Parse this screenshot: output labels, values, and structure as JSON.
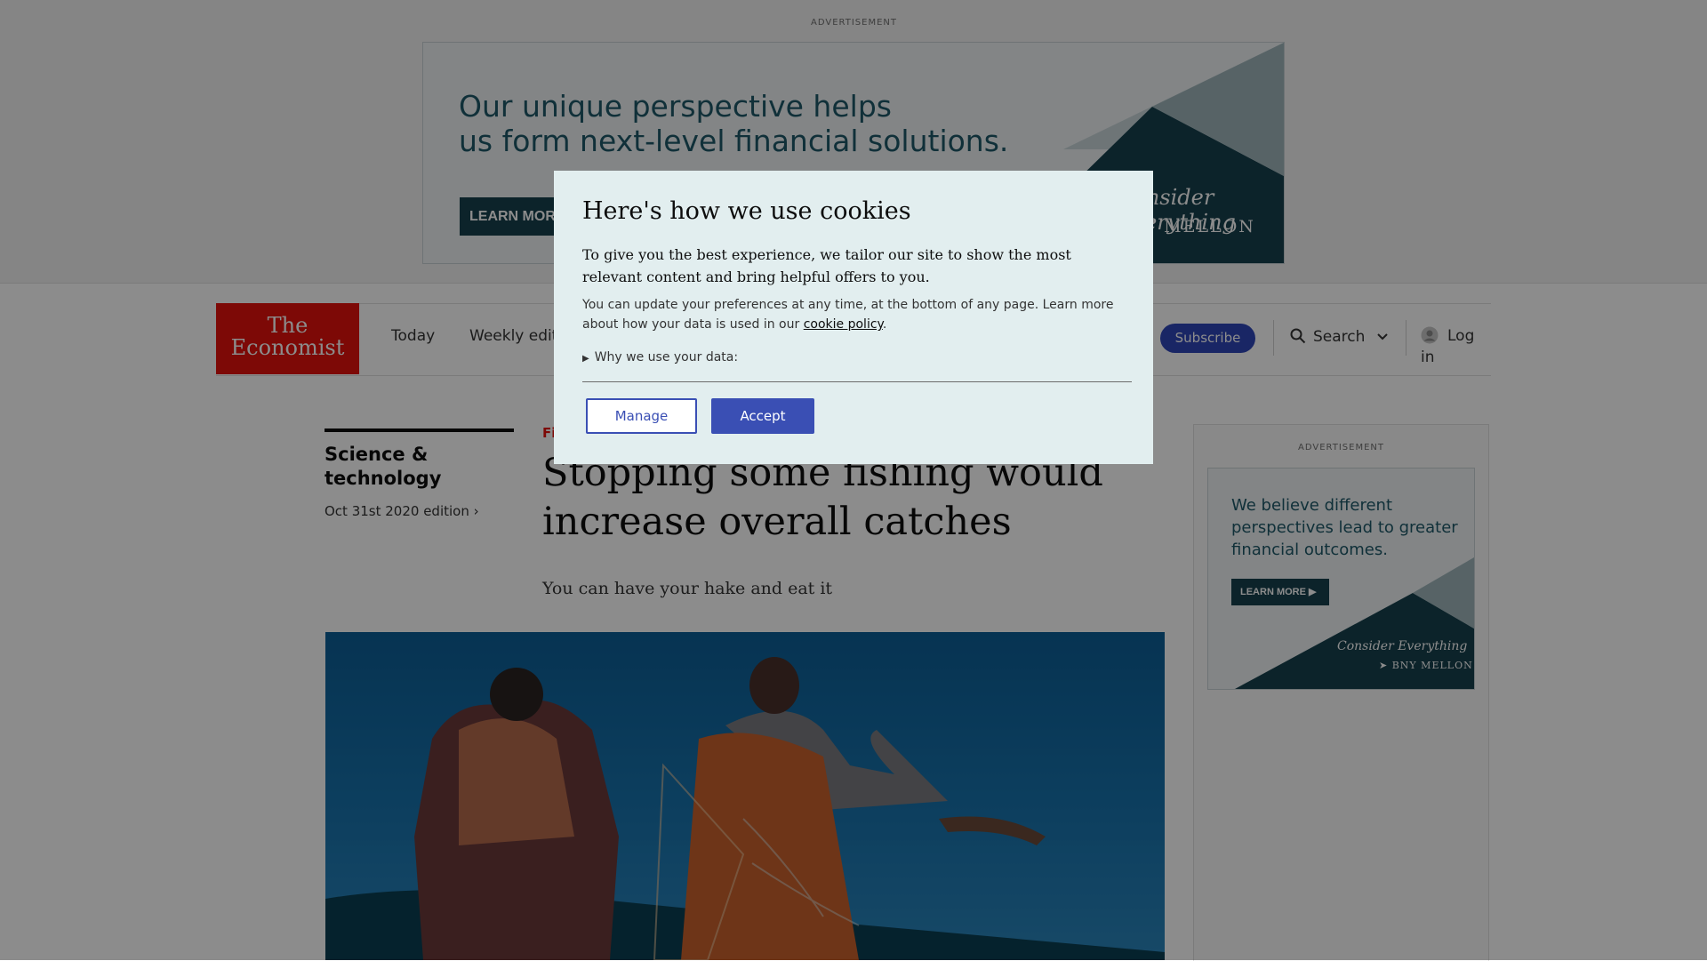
{
  "top_ad": {
    "label": "ADVERTISEMENT",
    "headline_line1": "Our unique perspective helps",
    "headline_line2": "us form next-level financial solutions.",
    "button": "LEARN MORE",
    "tagline": "Consider Everything",
    "brand": "BNY MELLON"
  },
  "nav": {
    "logo_line1": "The",
    "logo_line2": "Economist",
    "links": [
      "Today",
      "Weekly edition"
    ],
    "subscribe": "Subscribe",
    "search": "Search",
    "login": "Log in"
  },
  "article": {
    "section": "Science & technology",
    "edition": "Oct 31st 2020 edition",
    "kicker": "Fisheries",
    "headline": "Stopping some fishing would increase overall catches",
    "standfirst": "You can have your hake and eat it"
  },
  "side_ad": {
    "label": "ADVERTISEMENT",
    "headline": "We believe different perspectives lead to greater financial outcomes.",
    "button": "LEARN MORE",
    "tagline": "Consider Everything",
    "brand": "BNY MELLON"
  },
  "cookie_modal": {
    "title": "Here's how we use cookies",
    "lead": "To give you the best experience, we tailor our site to show the most relevant content and bring helpful offers to you.",
    "body_prefix": "You can update your preferences at any time, at the bottom of any page. Learn more about how your data is used in our",
    "body_link": "cookie policy",
    "body_suffix": ".",
    "details_summary": "Why we use your data:",
    "manage_button": "Manage",
    "accept_button": "Accept"
  },
  "colors": {
    "brand_red": "#e3120b",
    "accept_blue": "#3a4fb4",
    "ad_teal": "#17414d",
    "modal_bg": "#e2eeef"
  }
}
